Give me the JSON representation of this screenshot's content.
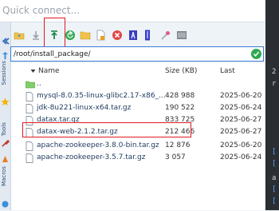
{
  "quick_connect": {
    "placeholder": "Quick connect..."
  },
  "side_tabs": [
    "Sessions",
    "Tools",
    "Macros"
  ],
  "path_bar": {
    "value": "/root/install_package/"
  },
  "table": {
    "columns": [
      "Name",
      "Size (KB)",
      "Last modified"
    ],
    "rows": [
      {
        "name": "..",
        "size": "",
        "modified": "",
        "type": "parent-folder"
      },
      {
        "name": "mysql-8.0.35-linux-glibc2.17-x86_...",
        "size": "428 988",
        "modified": "2025-06-20",
        "type": "file"
      },
      {
        "name": "jdk-8u221-linux-x64.tar.gz",
        "size": "190 522",
        "modified": "2025-06-24",
        "type": "file"
      },
      {
        "name": "datax.tar.gz",
        "size": "833 725",
        "modified": "2025-06-27",
        "type": "file"
      },
      {
        "name": "datax-web-2.1.2.tar.gz",
        "size": "212 466",
        "modified": "2025-06-27",
        "type": "file"
      },
      {
        "name": "apache-zookeeper-3.8.0-bin.tar.gz",
        "size": "12 876",
        "modified": "2025-06-20",
        "type": "file"
      },
      {
        "name": "apache-zookeeper-3.5.7.tar.gz",
        "size": "3 057",
        "modified": "2025-06-24",
        "type": "file"
      }
    ]
  },
  "terminal_strip": [
    "2",
    "r",
    "[",
    "[",
    "a",
    "[",
    "["
  ],
  "colors": {
    "highlight": "#e1191f",
    "accent": "#3a7bd5",
    "go": "#2fa84f"
  }
}
